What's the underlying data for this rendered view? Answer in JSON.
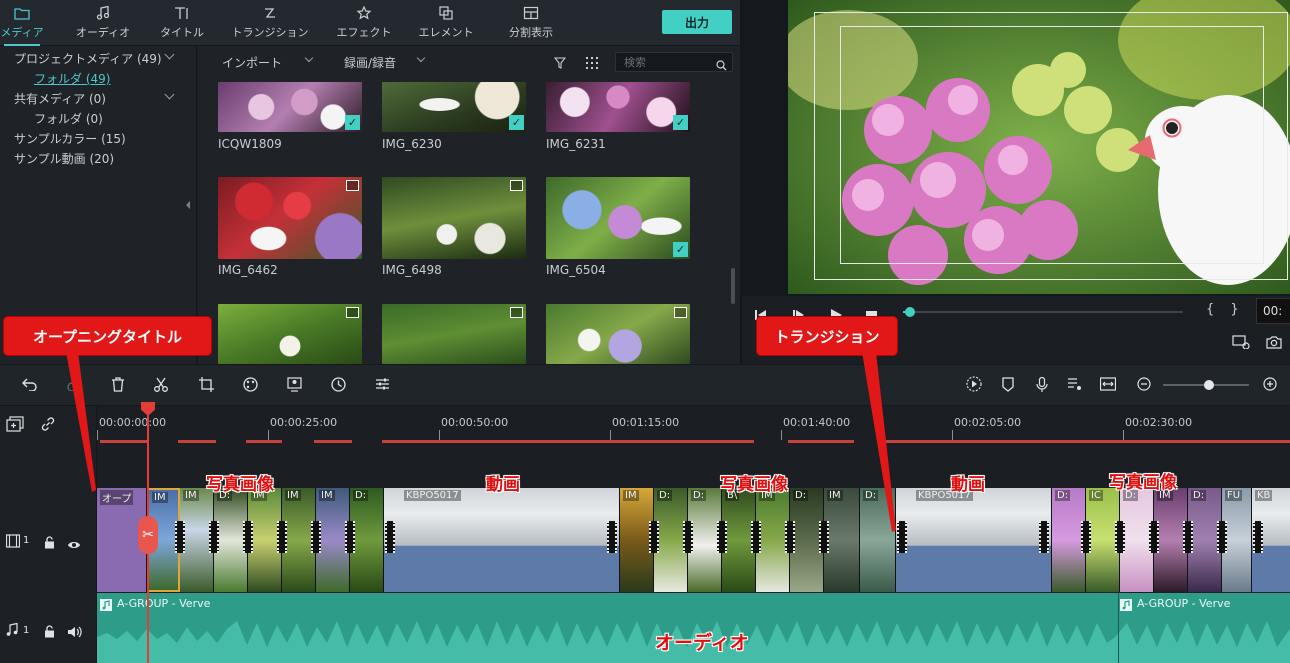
{
  "tabs": [
    {
      "label": "メディア",
      "icon": "folder-icon",
      "active": true
    },
    {
      "label": "オーディオ",
      "icon": "music-note-icon",
      "active": false
    },
    {
      "label": "タイトル",
      "icon": "text-icon",
      "active": false
    },
    {
      "label": "トランジション",
      "icon": "transition-icon",
      "active": false
    },
    {
      "label": "エフェクト",
      "icon": "effect-icon",
      "active": false
    },
    {
      "label": "エレメント",
      "icon": "element-icon",
      "active": false
    },
    {
      "label": "分割表示",
      "icon": "split-screen-icon",
      "active": false
    }
  ],
  "export_label": "出力",
  "sidebar": {
    "items": [
      {
        "label": "プロジェクトメディア (49)"
      },
      {
        "label": "フォルダ (49)"
      },
      {
        "label": "共有メディア (0)"
      },
      {
        "label": "フォルダ (0)"
      },
      {
        "label": "サンプルカラー (15)"
      },
      {
        "label": "サンプル動画 (20)"
      }
    ]
  },
  "media_toolbar": {
    "import_label": "インポート",
    "record_label": "録画/録音",
    "search_placeholder": "検索"
  },
  "media_items": [
    {
      "name": "ICQW1809",
      "checked": true
    },
    {
      "name": "IMG_6230",
      "checked": true
    },
    {
      "name": "IMG_6231",
      "checked": true
    },
    {
      "name": "IMG_6462",
      "checked": false
    },
    {
      "name": "IMG_6498",
      "checked": false
    },
    {
      "name": "IMG_6504",
      "checked": true
    },
    {
      "name": "",
      "checked": false
    },
    {
      "name": "",
      "checked": false
    },
    {
      "name": "",
      "checked": false
    }
  ],
  "player": {
    "timecode": "00:",
    "brackets": "{ }"
  },
  "ruler": {
    "labels": [
      "00:00:00:00",
      "00:00:25:00",
      "00:00:50:00",
      "00:01:15:00",
      "00:01:40:00",
      "00:02:05:00",
      "00:02:30:00"
    ]
  },
  "tracks": {
    "video_track_num": "1",
    "audio_track_num": "1"
  },
  "clips": {
    "title_clip": "オープ",
    "video_clip_a": "KBPO5017",
    "video_clip_b": "KBPO5017",
    "small_labels": [
      "IM",
      "IM",
      "D:",
      "IM",
      "IM",
      "IM",
      "D:",
      "IM",
      "D:",
      "D:",
      "B\\",
      "IM",
      "D:",
      "IM",
      "D:",
      "D:",
      "IC",
      "D:",
      "IM",
      "D:",
      "FU",
      "KB"
    ]
  },
  "audio": {
    "clip_a": "A-GROUP - Verve",
    "clip_b": "A-GROUP - Verve"
  },
  "annotations": {
    "opening_title": "オープニングタイトル",
    "transition": "トランジション",
    "photo1": "写真画像",
    "video1": "動画",
    "photo2": "写真画像",
    "video2": "動画",
    "photo3": "写真画像",
    "audio": "オーディオ"
  },
  "colors": {
    "accent": "#43d0c4",
    "playhead": "#e23d36",
    "audio_track": "#2d9d8a",
    "annotation_red": "#e21717"
  }
}
